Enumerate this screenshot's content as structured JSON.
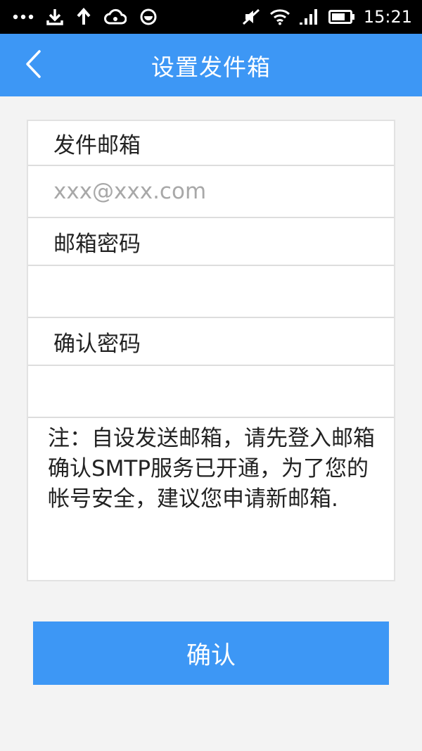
{
  "status_bar": {
    "icons": [
      "more-icon",
      "download-icon",
      "upload-icon",
      "cloud-icon",
      "app-status-icon",
      "mute-icon",
      "wifi-icon",
      "signal-icon",
      "battery-icon"
    ],
    "time": "15:21"
  },
  "header": {
    "back_icon": "chevron-left-icon",
    "title": "设置发件箱"
  },
  "form": {
    "sender_email_label": "发件邮箱",
    "sender_email_placeholder": "xxx@xxx.com",
    "sender_email_value": "",
    "password_label": "邮箱密码",
    "password_value": "",
    "confirm_password_label": "确认密码",
    "confirm_password_value": "",
    "note": "注：自设发送邮箱，请先登入邮箱确认SMTP服务已开通，为了您的帐号安全，建议您申请新邮箱."
  },
  "confirm_button": "确认",
  "colors": {
    "primary": "#3d97f5",
    "background": "#f3f3f3",
    "status_bar": "#000000",
    "placeholder": "#a8a8a8"
  }
}
